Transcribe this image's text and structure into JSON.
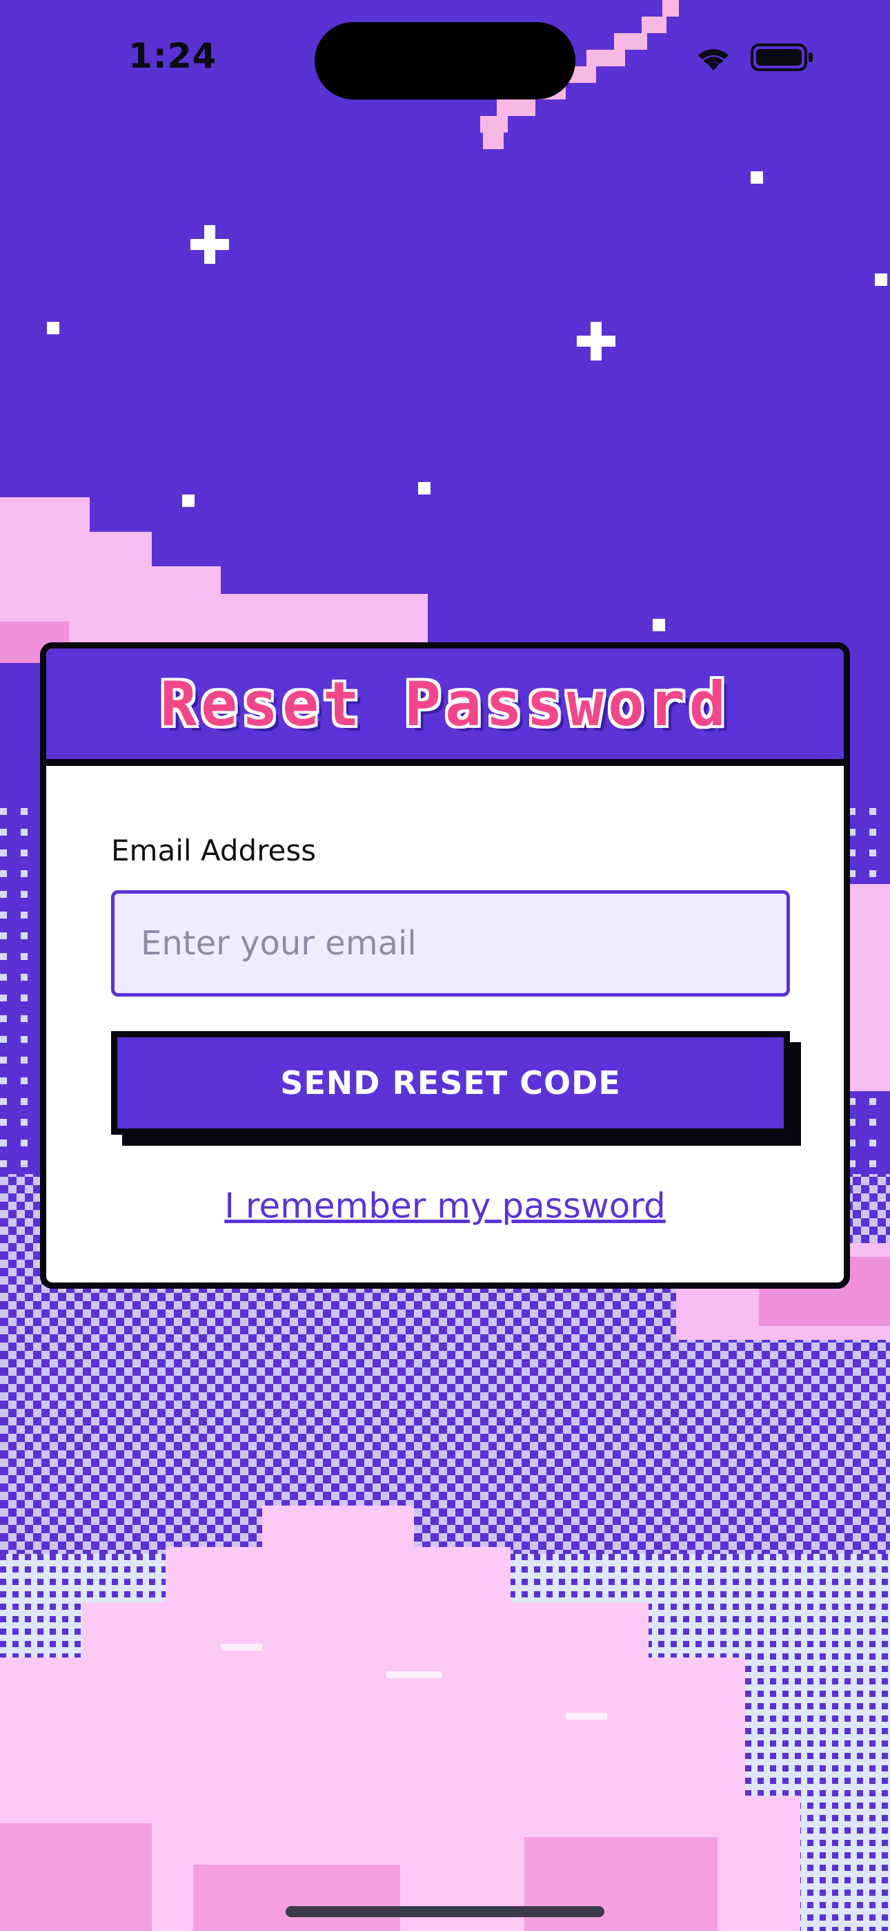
{
  "status_bar": {
    "time": "1:24",
    "icons": [
      "wifi-icon",
      "battery-icon"
    ]
  },
  "card": {
    "title": "Reset Password",
    "email_label": "Email Address",
    "email_placeholder": "Enter your email",
    "email_value": "",
    "send_button_label": "SEND RESET CODE",
    "remember_link": "I remember my password"
  },
  "colors": {
    "primary": "#5b33d6",
    "title_pink": "#f1478a",
    "sky": "#5a31d3",
    "cloud_pink": "#f8bdf0",
    "input_bg": "#efedfd"
  }
}
